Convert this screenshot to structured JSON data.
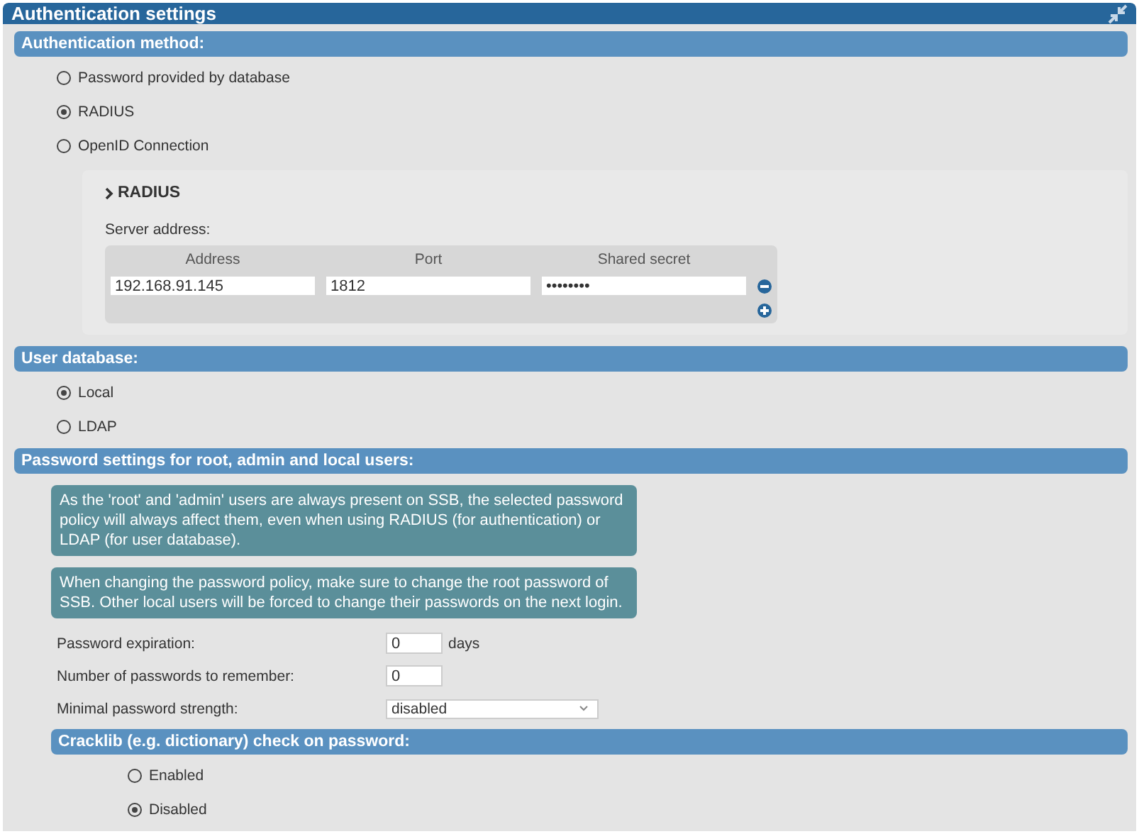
{
  "window": {
    "title": "Authentication settings"
  },
  "authentication_method": {
    "heading": "Authentication method:",
    "options": [
      {
        "label": "Password provided by database",
        "selected": false
      },
      {
        "label": "RADIUS",
        "selected": true
      },
      {
        "label": "OpenID Connection",
        "selected": false
      }
    ],
    "radius": {
      "heading": "RADIUS",
      "server_label": "Server address:",
      "columns": [
        "Address",
        "Port",
        "Shared secret"
      ],
      "rows": [
        {
          "address": "192.168.91.145",
          "port": "1812",
          "secret": "••••••••"
        }
      ]
    }
  },
  "user_database": {
    "heading": "User database:",
    "options": [
      {
        "label": "Local",
        "selected": true
      },
      {
        "label": "LDAP",
        "selected": false
      }
    ]
  },
  "password_settings": {
    "heading": "Password settings for root, admin and local users:",
    "notes": [
      "As the 'root' and 'admin' users are always present on SSB, the selected password policy will always affect them, even when using RADIUS (for authentication) or LDAP (for user database).",
      "When changing the password policy, make sure to change the root password of SSB. Other local users will be forced to change their passwords on the next login."
    ],
    "fields": [
      {
        "kind": "number",
        "label": "Password expiration:",
        "value": "0",
        "unit": "days"
      },
      {
        "kind": "number",
        "label": "Number of passwords to remember:",
        "value": "0"
      },
      {
        "kind": "select",
        "label": "Minimal password strength:",
        "value": "disabled"
      }
    ],
    "cracklib": {
      "heading": "Cracklib (e.g. dictionary) check on password:",
      "options": [
        {
          "label": "Enabled",
          "selected": false
        },
        {
          "label": "Disabled",
          "selected": true
        }
      ]
    }
  }
}
